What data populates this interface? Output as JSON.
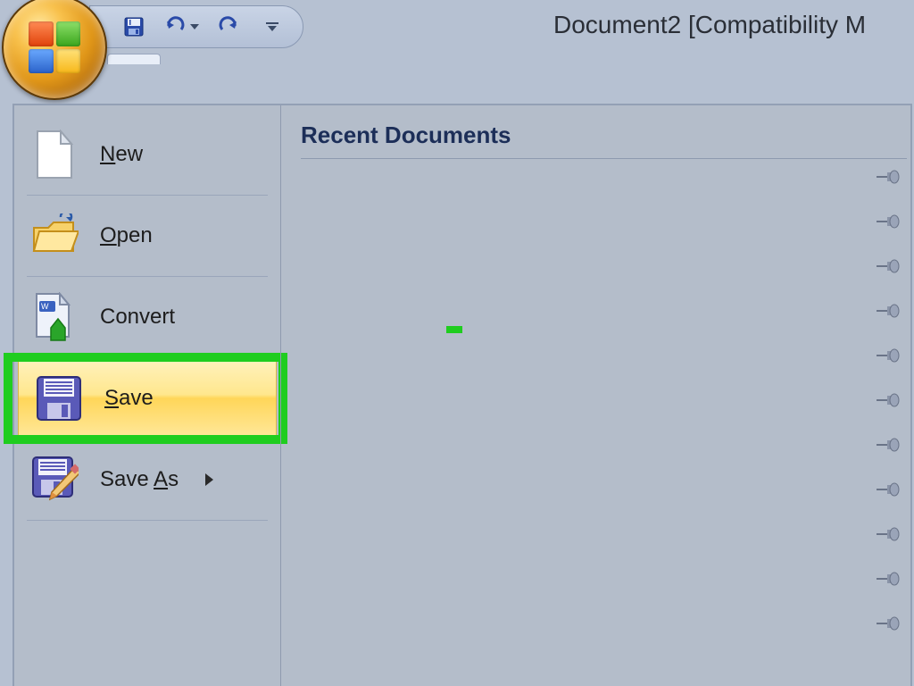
{
  "title": "Document2 [Compatibility M",
  "qat": {
    "save_tip": "Save",
    "undo_tip": "Undo",
    "redo_tip": "Redo",
    "customize_tip": "Customize Quick Access Toolbar"
  },
  "office_menu": {
    "new_label": "New",
    "open_label": "Open",
    "convert_label": "Convert",
    "save_label": "Save",
    "saveas_label": "Save As",
    "new_underline": "N",
    "open_underline": "O",
    "save_underline": "S",
    "saveas_underline": "A"
  },
  "recent": {
    "heading": "Recent Documents",
    "pin_count": 11
  },
  "colors": {
    "panel_bg": "#b4bdca",
    "accent_highlight": "#1fcd1f",
    "hover_gradient_top": "#fff2bd",
    "hover_gradient_bottom": "#ffd659",
    "heading": "#1c2e58"
  },
  "highlighted_item": "save"
}
